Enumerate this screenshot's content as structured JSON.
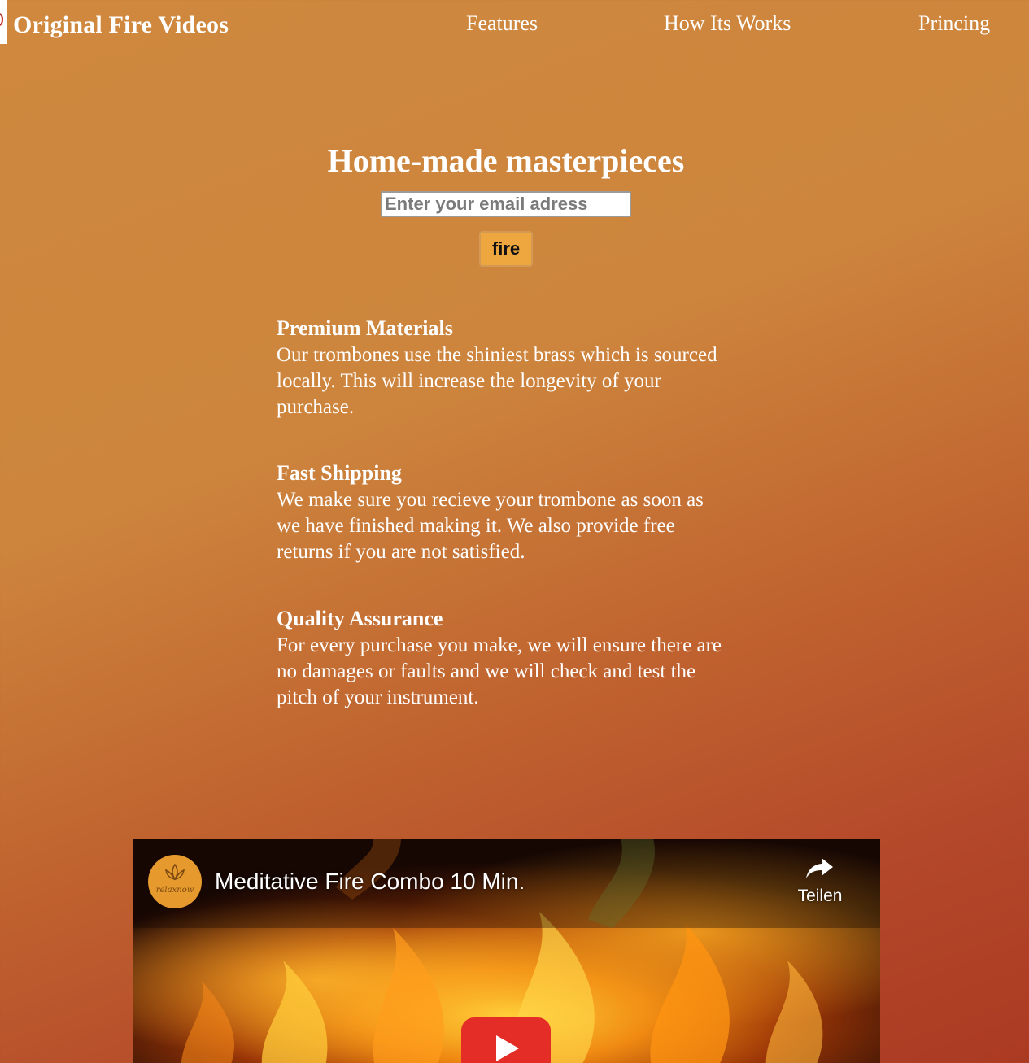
{
  "header": {
    "brand": "Original Fire Videos",
    "nav": [
      "Features",
      "How Its Works",
      "Princing"
    ]
  },
  "hero": {
    "title": "Home-made masterpieces",
    "email_placeholder": "Enter your email adress",
    "button_label": "fire"
  },
  "features": [
    {
      "title": "Premium Materials",
      "text": "Our trombones use the shiniest brass which is sourced locally. This will increase the longevity of your purchase."
    },
    {
      "title": "Fast Shipping",
      "text": "We make sure you recieve your trombone as soon as we have finished making it. We also provide free returns if you are not satisfied."
    },
    {
      "title": "Quality Assurance",
      "text": "For every purchase you make, we will ensure there are no damages or faults and we will check and test the pitch of your instrument."
    }
  ],
  "video": {
    "title": "Meditative Fire Combo 10 Min.",
    "channel_name": "relaxnow",
    "share_label": "Teilen",
    "channel_avatar_color": "#e69a2e",
    "play_button_color": "#e52d27"
  }
}
